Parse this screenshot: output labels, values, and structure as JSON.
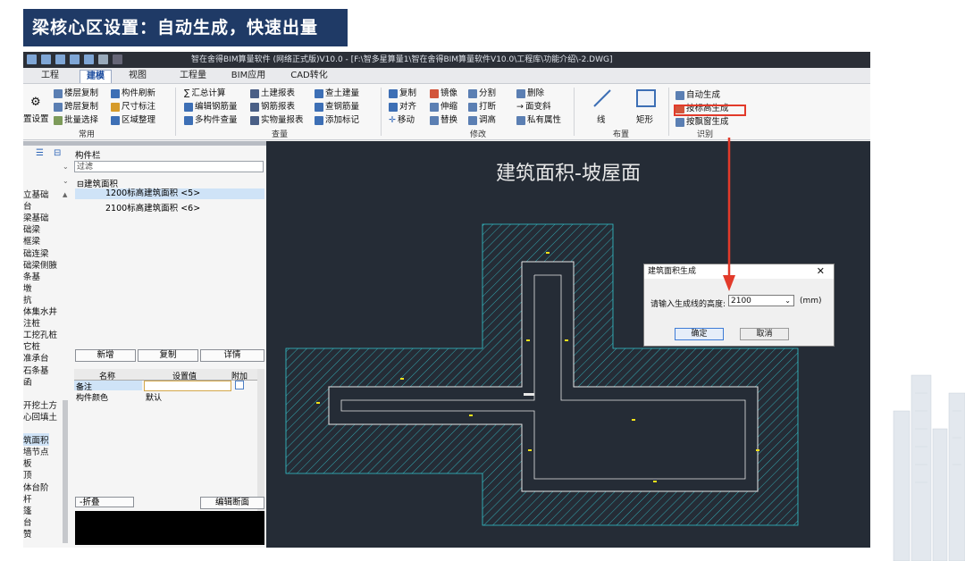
{
  "slide_title": "梁核心区设置：自动生成，快速出量",
  "app": {
    "window_title": "智在舍得BIM算量软件 (网络正式版)V10.0 - [F:\\智多星算量1\\智在舍得BIM算量软件V10.0\\工程库\\功能介绍\\-2.DWG]",
    "tabs": [
      "工程",
      "建模",
      "视图",
      "工程量",
      "BIM应用",
      "CAD转化"
    ],
    "active_tab": "建模"
  },
  "ribbon": {
    "col0": {
      "label": "置设置"
    },
    "col1": [
      "楼层复制",
      "跨层复制",
      "批量选择"
    ],
    "col2": [
      "构件刷新",
      "尺寸标注",
      "区域整理"
    ],
    "group_common": "常用",
    "col3": [
      "汇总计算",
      "编辑钢筋量",
      "多构件查量"
    ],
    "col4": [
      "土建报表",
      "钢筋报表",
      "实物量报表"
    ],
    "col5": [
      "查土建量",
      "查钢筋量",
      "添加标记"
    ],
    "group_query": "查量",
    "col6": [
      "复制",
      "对齐",
      "移动"
    ],
    "col7": [
      "镜像",
      "伸缩",
      "替换"
    ],
    "col8": [
      "分割",
      "打断",
      "调高"
    ],
    "col9": [
      "删除",
      "面变斜",
      "私有属性"
    ],
    "group_modify": "修改",
    "place": {
      "line": "线",
      "rect": "矩形",
      "group": "布置"
    },
    "recognize": {
      "items": [
        "自动生成",
        "按标高生成",
        "按飘窗生成"
      ],
      "group": "识别",
      "highlighted": "按标高生成"
    }
  },
  "left_panel": {
    "panel_title": "构件栏",
    "filter_placeholder": "过滤",
    "tree_root": "建筑面积",
    "tree_items": [
      "1200标高建筑面积 <5>",
      "2100标高建筑面积 <6>"
    ],
    "selected_tree_item": "1200标高建筑面积 <5>",
    "categories": [
      "立基础",
      "台",
      "梁基础",
      "础梁",
      "框梁",
      "础连梁",
      "础梁侧腋",
      "条基",
      "墩",
      "抗",
      "体集水井",
      "注桩",
      "工挖孔桩",
      "它桩",
      "准承台",
      "石条基",
      "函",
      "",
      "开挖土方",
      "心回填土",
      "",
      "筑面积",
      "墙节点",
      "板",
      "顶",
      "体台阶",
      "杆",
      "篷",
      "台",
      "赞"
    ],
    "selected_category": "筑面积",
    "buttons": [
      "新增",
      "复制",
      "详情"
    ],
    "prop_headers": [
      "名称",
      "设置值",
      "附加"
    ],
    "props": [
      {
        "name": "备注",
        "value": ""
      },
      {
        "name": "构件颜色",
        "value": "默认"
      }
    ],
    "bottom_buttons": [
      "折叠",
      "编辑断面"
    ]
  },
  "canvas": {
    "title": "建筑面积-坡屋面",
    "colors": {
      "background": "#252c36",
      "hatch": "#35c6cf",
      "outline": "#e8e8e8",
      "label": "#f2e21a"
    }
  },
  "dialog": {
    "title": "建筑面积生成",
    "prompt": "请输入生成线的高度:",
    "value": "2100",
    "unit": "(mm)",
    "ok": "确定",
    "cancel": "取消"
  }
}
